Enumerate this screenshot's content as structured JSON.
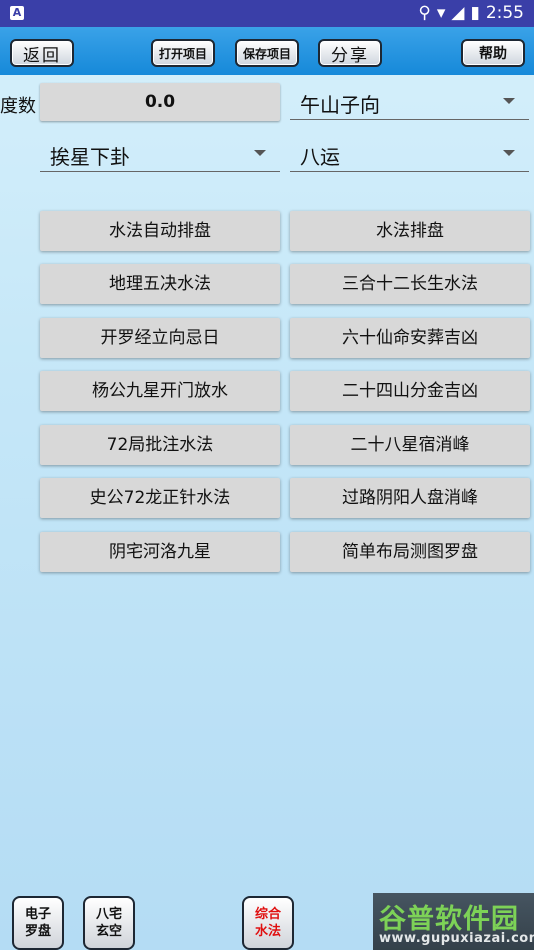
{
  "status_bar": {
    "time": "2:55",
    "app_icon": "A"
  },
  "toolbar": {
    "back": "返回",
    "open_project": "打开项目",
    "save_project": "保存项目",
    "share": "分享",
    "help": "帮助"
  },
  "settings": {
    "degree_label": "度数",
    "degree_value": "0.0",
    "mountain": "午山子向",
    "star_mode": "挨星下卦",
    "period": "八运"
  },
  "functions": [
    "水法自动排盘",
    "水法排盘",
    "地理五决水法",
    "三合十二长生水法",
    "开罗经立向忌日",
    "六十仙命安葬吉凶",
    "杨公九星开门放水",
    "二十四山分金吉凶",
    "72局批注水法",
    "二十八星宿消峰",
    "史公72龙正针水法",
    "过路阴阳人盘消峰",
    "阴宅河洛九星",
    "简单布局测图罗盘"
  ],
  "bottom_nav": {
    "compass": [
      "电子",
      "罗盘"
    ],
    "house": [
      "八宅",
      "玄空"
    ],
    "water": [
      "综合",
      "水法"
    ]
  },
  "watermark": {
    "name": "谷普软件园",
    "url": "www.gupuxiazai.com"
  },
  "colors": {
    "statusbar": "#3a3fa8",
    "toolbar": "#1689d9",
    "active_tab_text": "#e01010"
  }
}
